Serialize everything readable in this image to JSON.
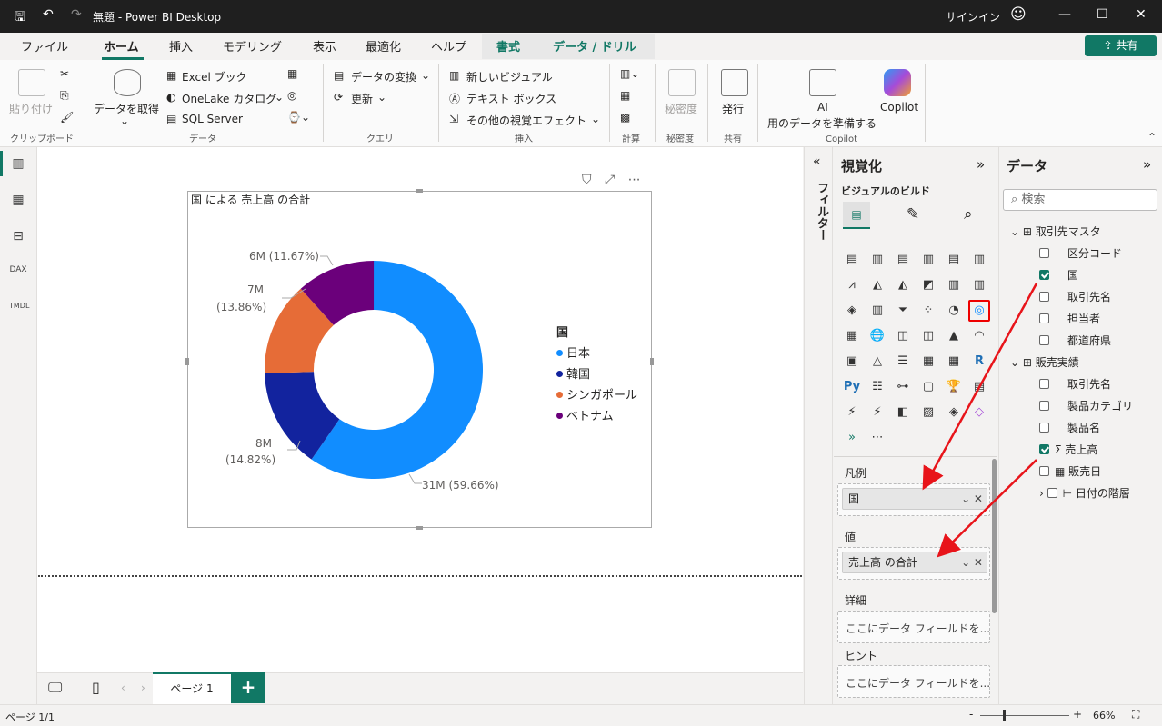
{
  "app": {
    "title": "無題 - Power BI Desktop",
    "signin": "サインイン"
  },
  "menu": {
    "tabs": [
      "ファイル",
      "ホーム",
      "挿入",
      "モデリング",
      "表示",
      "最適化",
      "ヘルプ",
      "書式",
      "データ / ドリル"
    ],
    "share": "共有"
  },
  "ribbon": {
    "clipboard": {
      "paste": "貼り付け",
      "label": "クリップボード"
    },
    "data": {
      "get_data": "データを取得",
      "excel": "Excel ブック",
      "onelake": "OneLake カタログ",
      "sql": "SQL Server",
      "label": "データ"
    },
    "query": {
      "transform": "データの変換",
      "refresh": "更新",
      "label": "クエリ"
    },
    "insert": {
      "new_visual": "新しいビジュアル",
      "textbox": "テキスト ボックス",
      "more_visuals": "その他の視覚エフェクト",
      "label": "挿入"
    },
    "calc": {
      "label": "計算"
    },
    "sensitivity": {
      "btn": "秘密度",
      "label": "秘密度"
    },
    "share": {
      "publish": "発行",
      "label": "共有"
    },
    "copilot": {
      "ai_prep_1": "AI",
      "ai_prep_2": "用のデータを準備する",
      "copilot": "Copilot",
      "label": "Copilot"
    }
  },
  "visual": {
    "title": "国 による 売上高 の合計"
  },
  "chart_data": {
    "type": "pie",
    "title": "国 による 売上高 の合計",
    "legend_title": "国",
    "legend_position": "right",
    "categories": [
      "日本",
      "韓国",
      "シンガポール",
      "ベトナム"
    ],
    "values": [
      31,
      8,
      7,
      6
    ],
    "value_labels": [
      "31M (59.66%)",
      "8M",
      "7M",
      "6M (11.67%)"
    ],
    "percent_labels": [
      "",
      "(14.82%)",
      "(13.86%)",
      ""
    ],
    "percentages": [
      59.66,
      14.82,
      13.86,
      11.67
    ],
    "colors": [
      "#118dff",
      "#12239e",
      "#e66c37",
      "#6b007b"
    ]
  },
  "pages": {
    "page1": "ページ 1",
    "status": "ページ 1/1",
    "zoom": "66%"
  },
  "filters": {
    "label": "フィルター"
  },
  "viz_pane": {
    "title": "視覚化",
    "subtitle": "ビジュアルのビルド",
    "legend_label": "凡例",
    "legend_field": "国",
    "values_label": "値",
    "values_field": "売上高 の合計",
    "details_label": "詳細",
    "details_ph": "ここにデータ フィールドを...",
    "tooltips_label": "ヒント",
    "tooltips_ph": "ここにデータ フィールドを...",
    "more": "⋯"
  },
  "data_pane": {
    "title": "データ",
    "search_placeholder": "検索",
    "tables": [
      {
        "name": "取引先マスタ",
        "fields": [
          {
            "name": "区分コード",
            "checked": false
          },
          {
            "name": "国",
            "checked": true
          },
          {
            "name": "取引先名",
            "checked": false
          },
          {
            "name": "担当者",
            "checked": false
          },
          {
            "name": "都道府県",
            "checked": false
          }
        ]
      },
      {
        "name": "販売実績",
        "fields": [
          {
            "name": "取引先名",
            "checked": false
          },
          {
            "name": "製品カテゴリ",
            "checked": false
          },
          {
            "name": "製品名",
            "checked": false
          },
          {
            "name": "売上高",
            "checked": true,
            "sigma": "Σ"
          },
          {
            "name": "販売日",
            "checked": false
          }
        ]
      }
    ],
    "date_hierarchy": "日付の階層"
  }
}
